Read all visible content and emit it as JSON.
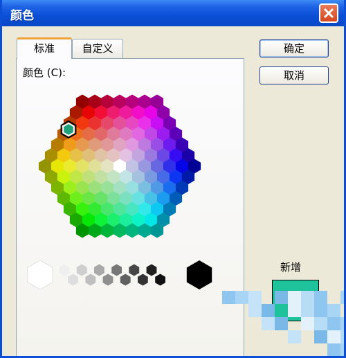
{
  "window": {
    "title": "颜色",
    "close_icon": "close-icon"
  },
  "tabs": [
    {
      "label": "标准",
      "active": true
    },
    {
      "label": "自定义",
      "active": false
    }
  ],
  "color_label": "颜色 (C):",
  "buttons": {
    "ok_label": "确定",
    "cancel_label": "取消"
  },
  "new_color": {
    "label": "新增",
    "color": "#1fc39b"
  },
  "selected_color": "#21a07c",
  "grays": [
    "#ffffff",
    "#efefef",
    "#dedede",
    "#cfcfcf",
    "#bfbfbf",
    "#a9a9a9",
    "#8f8f8f",
    "#777777",
    "#606060",
    "#474747",
    "#333333",
    "#202020",
    "#111111",
    "#000000"
  ]
}
